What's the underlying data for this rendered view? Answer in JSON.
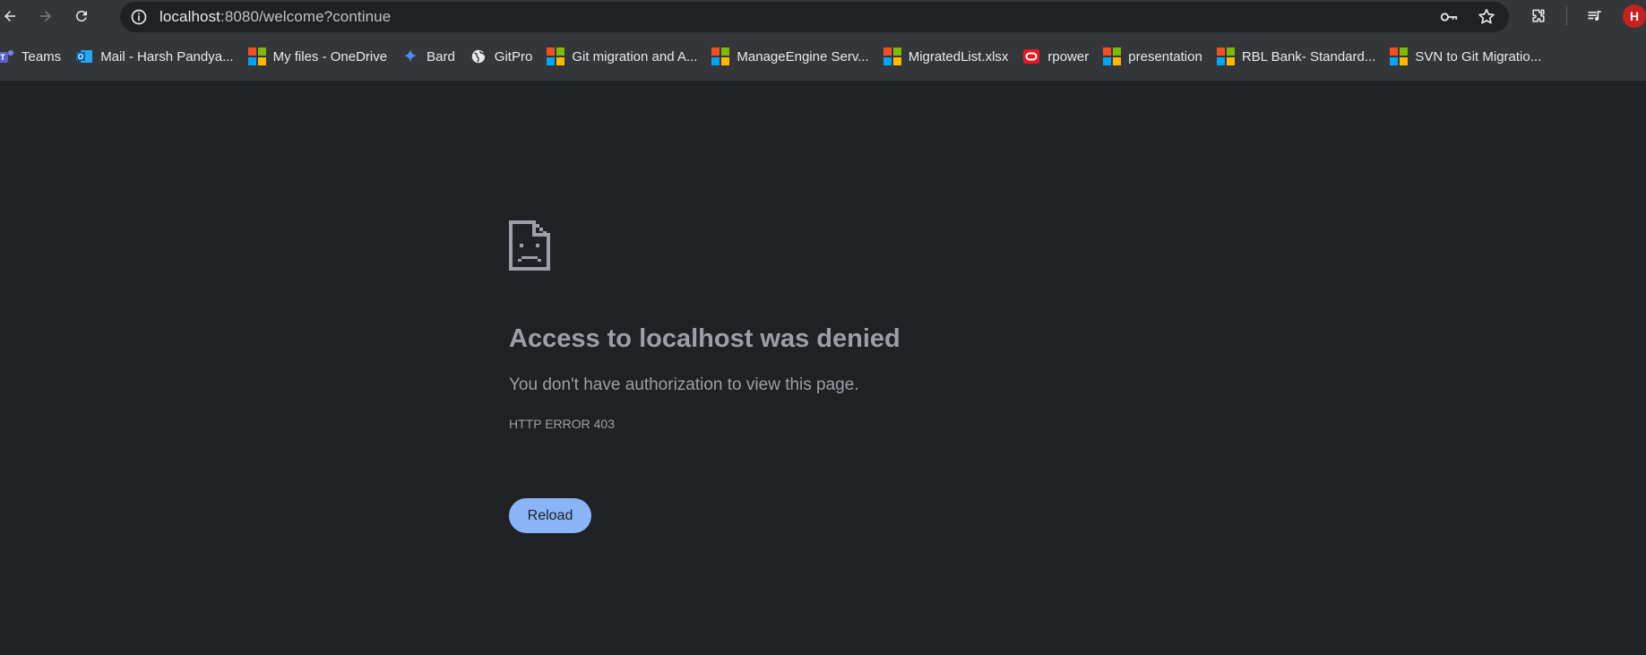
{
  "browser": {
    "url_host": "localhost",
    "url_rest": ":8080/welcome?continue",
    "avatar_initial": "H"
  },
  "bookmarks": [
    {
      "label": "Teams",
      "icon": "teams-icon"
    },
    {
      "label": "Mail - Harsh Pandya...",
      "icon": "outlook-icon"
    },
    {
      "label": "My files - OneDrive",
      "icon": "microsoft-icon"
    },
    {
      "label": "Bard",
      "icon": "bard-sparkle-icon"
    },
    {
      "label": "GitPro",
      "icon": "globe-icon"
    },
    {
      "label": "Git migration and A...",
      "icon": "microsoft-icon"
    },
    {
      "label": "ManageEngine Serv...",
      "icon": "microsoft-icon"
    },
    {
      "label": "MigratedList.xlsx",
      "icon": "microsoft-icon"
    },
    {
      "label": "rpower",
      "icon": "oracle-icon"
    },
    {
      "label": "presentation",
      "icon": "microsoft-icon"
    },
    {
      "label": "RBL Bank- Standard...",
      "icon": "microsoft-icon"
    },
    {
      "label": "SVN to Git Migratio...",
      "icon": "microsoft-icon"
    }
  ],
  "error_page": {
    "title": "Access to localhost was denied",
    "description": "You don't have authorization to view this page.",
    "error_code": "HTTP ERROR 403",
    "reload_label": "Reload"
  },
  "colors": {
    "page_background": "#202124",
    "toolbar_background": "#35363a",
    "reload_button": "#8ab4f8",
    "text_muted": "#9aa0a6"
  }
}
